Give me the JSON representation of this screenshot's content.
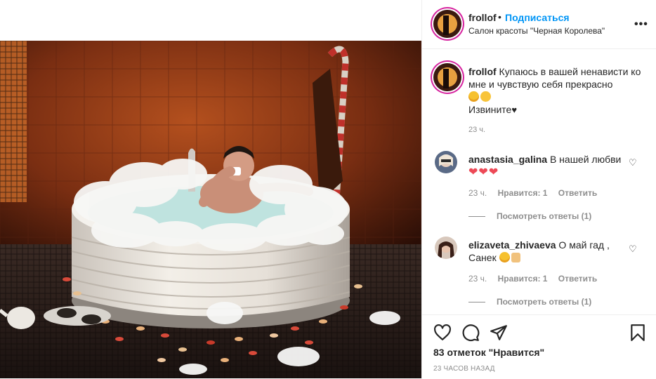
{
  "header": {
    "username": "frollof",
    "separator": "•",
    "follow_label": "Подписаться",
    "location": "Салон красоты \"Черная Королева\"",
    "more_icon": "more-horizontal-icon"
  },
  "caption": {
    "username": "frollof",
    "text": "Купаюсь в вашей ненависти ко мне и чувствую себя прекрасно",
    "line2": "Извините",
    "time": "23 ч."
  },
  "comments": [
    {
      "username": "anastasia_galina",
      "text": "В нашей любви",
      "emoji": "❤❤❤",
      "time": "23 ч.",
      "likes": "Нравится: 1",
      "reply": "Ответить",
      "view_replies": "Посмотреть ответы (1)"
    },
    {
      "username": "elizaveta_zhivaeva",
      "text": "О май гад , Санек",
      "time": "23 ч.",
      "likes": "Нравится: 1",
      "reply": "Ответить",
      "view_replies": "Посмотреть ответы (1)"
    }
  ],
  "actions": {
    "icons": [
      "heart-icon",
      "comment-icon",
      "share-icon",
      "bookmark-icon"
    ],
    "likes_text": "83 отметок \"Нравится\"",
    "posted_text": "23 ЧАСОВ НАЗАД"
  },
  "colors": {
    "link_blue": "#0095f6",
    "muted": "#8e8e8e",
    "border": "#efefef",
    "heart_red": "#ed4956"
  }
}
